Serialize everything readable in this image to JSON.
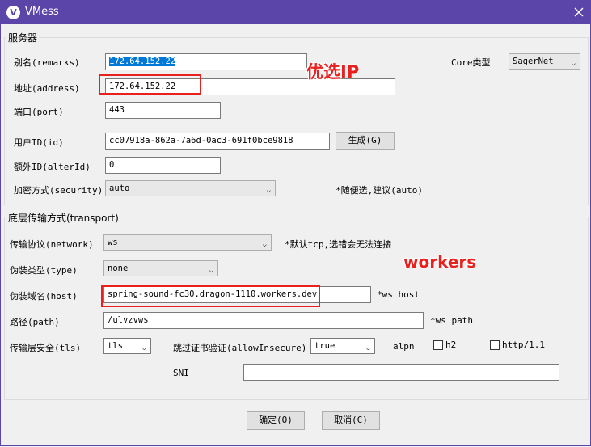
{
  "window": {
    "title": "VMess",
    "logo_letter": "V"
  },
  "server": {
    "legend": "服务器",
    "remarks_label": "别名(remarks)",
    "remarks_value": "172.64.152.22",
    "core_label": "Core类型",
    "core_value": "SagerNet",
    "address_label": "地址(address)",
    "address_value": "172.64.152.22",
    "port_label": "端口(port)",
    "port_value": "443",
    "id_label": "用户ID(id)",
    "id_value": "cc07918a-862a-7a6d-0ac3-691f0bce9818",
    "generate_label": "生成(G)",
    "alterid_label": "额外ID(alterId)",
    "alterid_value": "0",
    "security_label": "加密方式(security)",
    "security_value": "auto",
    "security_hint": "*随便选,建议(auto)"
  },
  "transport": {
    "legend": "底层传输方式(transport)",
    "network_label": "传输协议(network)",
    "network_value": "ws",
    "network_hint": "*默认tcp,选错会无法连接",
    "type_label": "伪装类型(type)",
    "type_value": "none",
    "host_label": "伪装域名(host)",
    "host_value": "spring-sound-fc30.dragon-1110.workers.dev",
    "host_hint": "*ws host",
    "path_label": "路径(path)",
    "path_value": "/ulvzvws",
    "path_hint": "*ws path",
    "tls_label": "传输层安全(tls)",
    "tls_value": "tls",
    "insecure_label": "跳过证书验证(allowInsecure)",
    "insecure_value": "true",
    "alpn_label": "alpn",
    "alpn_options": [
      {
        "label": "h2",
        "checked": false
      },
      {
        "label": "http/1.1",
        "checked": false
      }
    ],
    "sni_label": "SNI",
    "sni_value": ""
  },
  "footer": {
    "ok_label": "确定(O)",
    "cancel_label": "取消(C)"
  },
  "annotations": {
    "ip_note": "优选IP",
    "workers_note": "workers",
    "color": "#e8201e"
  },
  "colors": {
    "titlebar": "#5b45a8",
    "selection": "#0078d7"
  }
}
